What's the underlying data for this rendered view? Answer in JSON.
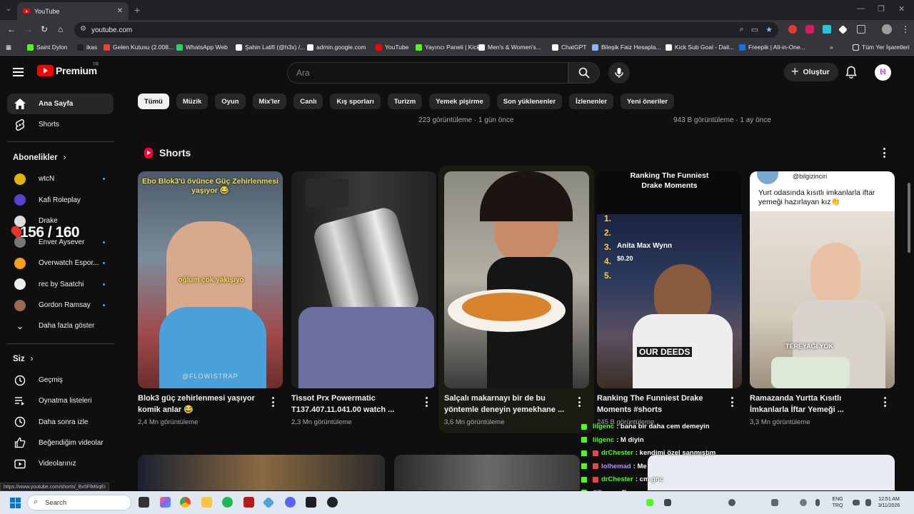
{
  "browser": {
    "tab_title": "YouTube",
    "url": "youtube.com",
    "bookmarks": [
      {
        "label": "Saint Dylon",
        "color": "#53fc18"
      },
      {
        "label": "ikas",
        "color": "#222222"
      },
      {
        "label": "Gelen Kutusu (2.008...",
        "color": "#ea4335"
      },
      {
        "label": "WhatsApp Web",
        "color": "#25d366"
      },
      {
        "label": "Şahin Latifi (@h3x) /...",
        "color": "#ffffff"
      },
      {
        "label": "admin.google.com",
        "color": "#ffffff"
      },
      {
        "label": "YouTube",
        "color": "#ff0000"
      },
      {
        "label": "Yayıncı Paneli | Kick",
        "color": "#53fc18"
      },
      {
        "label": "Men's & Women's...",
        "color": "#ffffff"
      },
      {
        "label": "ChatGPT",
        "color": "#ffffff"
      },
      {
        "label": "Bileşik Faiz Hesapla...",
        "color": "#8ab4f8"
      },
      {
        "label": "Kick Sub Goal - Dail...",
        "color": "#ffffff"
      },
      {
        "label": "Freepik | All-in-One...",
        "color": "#1273eb"
      }
    ],
    "all_bookmarks": "Tüm Yer İşaretleri",
    "status_url": "https://www.youtube.com/shorts/_Bx5FlM6qEI"
  },
  "header": {
    "logo_text": "Premium",
    "region": "TR",
    "search_placeholder": "Ara",
    "create_label": "Oluştur",
    "avatar_letter": "ℍ"
  },
  "sidebar": {
    "main": [
      {
        "label": "Ana Sayfa",
        "icon": "home-icon"
      },
      {
        "label": "Shorts",
        "icon": "shorts-icon"
      }
    ],
    "subscriptions_title": "Abonelikler",
    "subscriptions": [
      {
        "label": "wtcN",
        "color": "#e5b400",
        "dot": true
      },
      {
        "label": "Kafi Roleplay",
        "color": "#5b3fd1",
        "dot": false
      },
      {
        "label": "Drake",
        "color": "#dddddd",
        "dot": false
      },
      {
        "label": "Enver Aysever",
        "color": "#777777",
        "dot": true
      },
      {
        "label": "Overwatch Espor...",
        "color": "#f99e1a",
        "dot": true
      },
      {
        "label": "rec by Saatchi",
        "color": "#eeeeee",
        "dot": true
      },
      {
        "label": "Gordon Ramsay",
        "color": "#9a6b4f",
        "dot": true
      }
    ],
    "show_more": "Daha fazla göster",
    "you_title": "Siz",
    "you_items": [
      {
        "label": "Geçmiş",
        "icon": "history-icon"
      },
      {
        "label": "Oynatma listeleri",
        "icon": "playlists-icon"
      },
      {
        "label": "Daha sonra izle",
        "icon": "clock-icon"
      },
      {
        "label": "Beğendiğim videolar",
        "icon": "thumbs-up-icon"
      },
      {
        "label": "Videolarınız",
        "icon": "video-icon"
      }
    ],
    "overlay_count": "156 / 160"
  },
  "chips": [
    "Tümü",
    "Müzik",
    "Oyun",
    "Mix'ler",
    "Canlı",
    "Kış sporları",
    "Turizm",
    "Yemek pişirme",
    "Son yüklenenler",
    "İzlenenler",
    "Yeni öneriler"
  ],
  "previous_row": [
    "223 görüntüleme · 1 gün önce",
    "943 B görüntüleme · 1 ay önce"
  ],
  "shorts": {
    "title": "Shorts",
    "items": [
      {
        "title": "Blok3 güç zehirlenmesi yaşıyor komik anlar 😂",
        "views": "2,4 Mn görüntüleme",
        "caption": "Ebo Blok3'ü övünce Güç Zehirlenmesi yaşıyor 😂",
        "caption2": "oğlum çok yakışıyo",
        "watermark": "@FLOWISTRAP"
      },
      {
        "title": "Tissot Prx Powermatic T137.407.11.041.00 watch ...",
        "views": "2,3 Mn görüntüleme"
      },
      {
        "title": "Salçalı makarnayı bir de bu yöntemle deneyin yemekhane ...",
        "views": "3,6 Mn görüntüleme"
      },
      {
        "title": "Ranking The Funniest Drake Moments #shorts",
        "views": "245 B görüntüleme",
        "caption": "Ranking The Funniest",
        "caption_accent": "Drake Moments",
        "ranks": [
          "1.",
          "2.",
          "3.",
          "4.",
          "5."
        ],
        "rank3": "Anita Max Wynn",
        "rank4": "$0.20",
        "banner": "OUR DEEDS"
      },
      {
        "title": "Ramazanda Yurtta Kısıtlı İmkanlarla İftar Yemeği ...",
        "views": "3,3 Mn görüntüleme",
        "handle": "@bilgizinciri",
        "caption": "Yurt odasında kısıtlı imkanlarla iftar yemeği hazırlayan kız👏",
        "tag": "TEREYAĞI YOK"
      }
    ]
  },
  "chat": [
    {
      "user": "lilgenc",
      "text": ": bana bir daha cem demeyin",
      "badge": false,
      "user_color": "#53fc18"
    },
    {
      "user": "lilgenc",
      "text": ": M diyin",
      "badge": false,
      "user_color": "#53fc18"
    },
    {
      "user": "drChester",
      "text": ": kendimi özel sanmıştım",
      "badge": true,
      "user_color": "#53fc18"
    },
    {
      "user": "lolhemad",
      "text": ": Me",
      "badge": true,
      "user_color": "#b58cff"
    },
    {
      "user": "drChester",
      "text": ": cm gnc",
      "badge": true,
      "user_color": "#53fc18"
    },
    {
      "user": "CTaner",
      "text": ": Er",
      "badge": false,
      "user_color": "#b58cff"
    }
  ],
  "taskbar": {
    "search": "Search",
    "lang": "ENG",
    "lang2": "TRQ",
    "time": "12:51 AM",
    "date": "3/11/2026"
  }
}
